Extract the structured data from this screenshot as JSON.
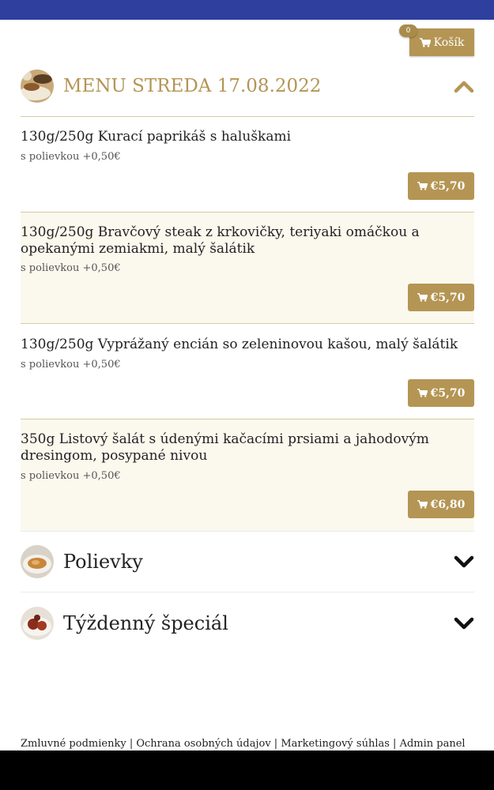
{
  "header": {
    "cart_label": "Košík",
    "cart_count": "0"
  },
  "menu": {
    "title": "MENU STREDA 17.08.2022",
    "items": [
      {
        "name": "130g/250g Kurací paprikáš s haluškami",
        "note": "s polievkou +0,50€",
        "price": "€5,70"
      },
      {
        "name": "130g/250g Bravčový steak z krkovičky, teriyaki omáčkou a opekanými zemiakmi, malý šalátik",
        "note": "s polievkou +0,50€",
        "price": "€5,70"
      },
      {
        "name": "130g/250g Vyprážaný encián so zeleninovou kašou, malý šalátik",
        "note": "s polievkou +0,50€",
        "price": "€5,70"
      },
      {
        "name": "350g Listový šalát s údenými kačacími prsiami a jahodovým dresingom, posypané nivou",
        "note": "s polievkou +0,50€",
        "price": "€6,80"
      }
    ]
  },
  "categories": [
    {
      "title": "Polievky"
    },
    {
      "title": "Týždenný špeciál"
    }
  ],
  "footer": {
    "links": [
      "Zmluvné podmienky",
      "Ochrana osobných údajov",
      "Marketingový súhlas",
      "Admin panel"
    ],
    "separator": " | "
  },
  "colors": {
    "topbar": "#2e3f9e",
    "accent": "#b49554",
    "alt_row": "#fbf8ee"
  }
}
